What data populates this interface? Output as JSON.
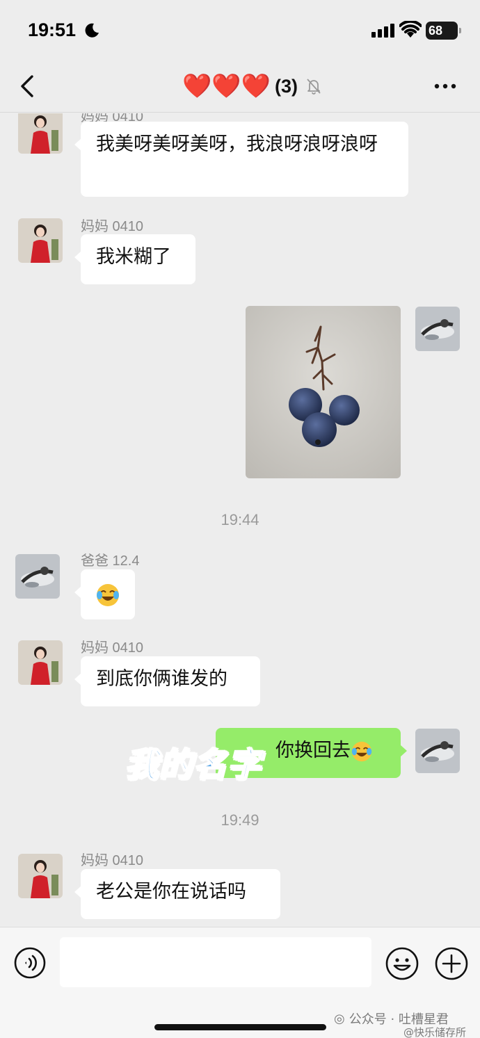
{
  "status_bar": {
    "time": "19:51",
    "battery": "68"
  },
  "nav": {
    "hearts": "❤️❤️❤️",
    "count": "(3)"
  },
  "messages": {
    "m1": {
      "sender": "妈妈 0410",
      "text": "我美呀美呀美呀，我浪呀浪呀浪呀"
    },
    "m2": {
      "sender": "妈妈 0410",
      "text": "我米糊了"
    },
    "t1": "19:44",
    "m4": {
      "sender": "爸爸 12.4"
    },
    "m5": {
      "sender": "妈妈 0410",
      "text": "到底你俩谁发的"
    },
    "m6": {
      "text": "你换回去",
      "sticker": "我的名字"
    },
    "t2": "19:49",
    "m7": {
      "sender": "妈妈 0410",
      "text": "老公是你在说话吗"
    }
  },
  "input": {
    "placeholder": ""
  },
  "footer": {
    "watermark": "公众号 · 吐槽星君",
    "watermark2": "@快乐储存所"
  },
  "colors": {
    "bubble_green": "#95ec69",
    "background": "#ededed",
    "heart": "#e01e26"
  },
  "icons": [
    "moon-icon",
    "signal-icon",
    "wifi-icon",
    "battery-icon",
    "back-icon",
    "mute-bell-icon",
    "more-icon",
    "voice-icon",
    "emoji-icon",
    "plus-icon",
    "crying-laughing-emoji"
  ]
}
